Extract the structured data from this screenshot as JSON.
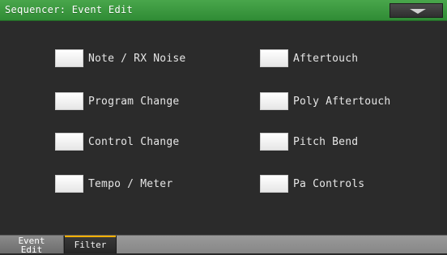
{
  "window": {
    "title": "Sequencer: Event Edit",
    "title_bar_color": "#3f9f44",
    "background_color": "#2b2b2b"
  },
  "checkboxes": [
    {
      "label": "Note / RX Noise",
      "checked": false
    },
    {
      "label": "Program Change",
      "checked": false
    },
    {
      "label": "Control Change",
      "checked": false
    },
    {
      "label": "Tempo / Meter",
      "checked": false
    },
    {
      "label": "Aftertouch",
      "checked": false
    },
    {
      "label": "Poly Aftertouch",
      "checked": false
    },
    {
      "label": "Pitch Bend",
      "checked": false
    },
    {
      "label": "Pa Controls",
      "checked": false
    }
  ],
  "tabs": {
    "event_edit_line1": "Event",
    "event_edit_line2": "Edit",
    "filter": "Filter",
    "active": "Filter",
    "accent_color": "#ffb000"
  },
  "icons": {
    "menu": "chevron-down-icon"
  }
}
